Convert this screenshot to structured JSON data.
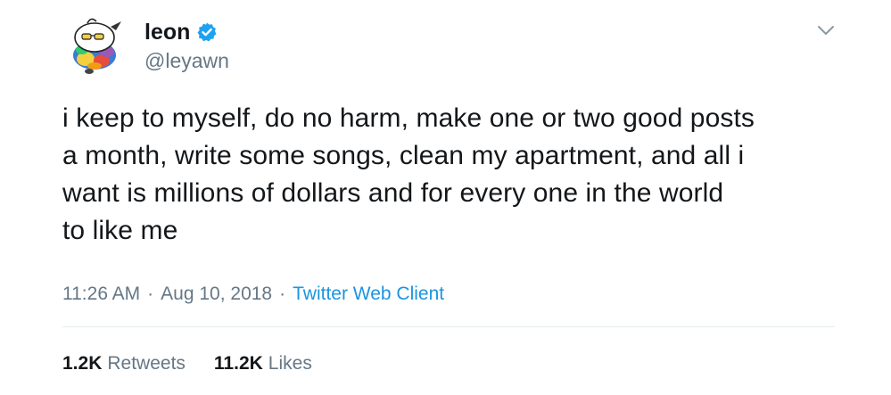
{
  "author": {
    "display_name": "leon",
    "handle": "@leyawn",
    "verified": true,
    "avatar_icon": "duck-cartoon-avatar"
  },
  "tweet": {
    "text": "i keep to myself, do no harm, make one or two good posts\na month, write some songs, clean my apartment, and all i\nwant is millions of dollars and for every one in the world\nto like me",
    "time": "11:26 AM",
    "separator": "·",
    "date": "Aug 10, 2018",
    "client": "Twitter Web Client"
  },
  "stats": {
    "retweets_count": "1.2K",
    "retweets_label": "Retweets",
    "likes_count": "11.2K",
    "likes_label": "Likes"
  },
  "icons": {
    "verified": "verified-badge-icon",
    "menu": "chevron-down-icon"
  },
  "colors": {
    "text": "#14171a",
    "secondary": "#657786",
    "accent": "#1b95e0",
    "divider": "#e6ecf0"
  }
}
